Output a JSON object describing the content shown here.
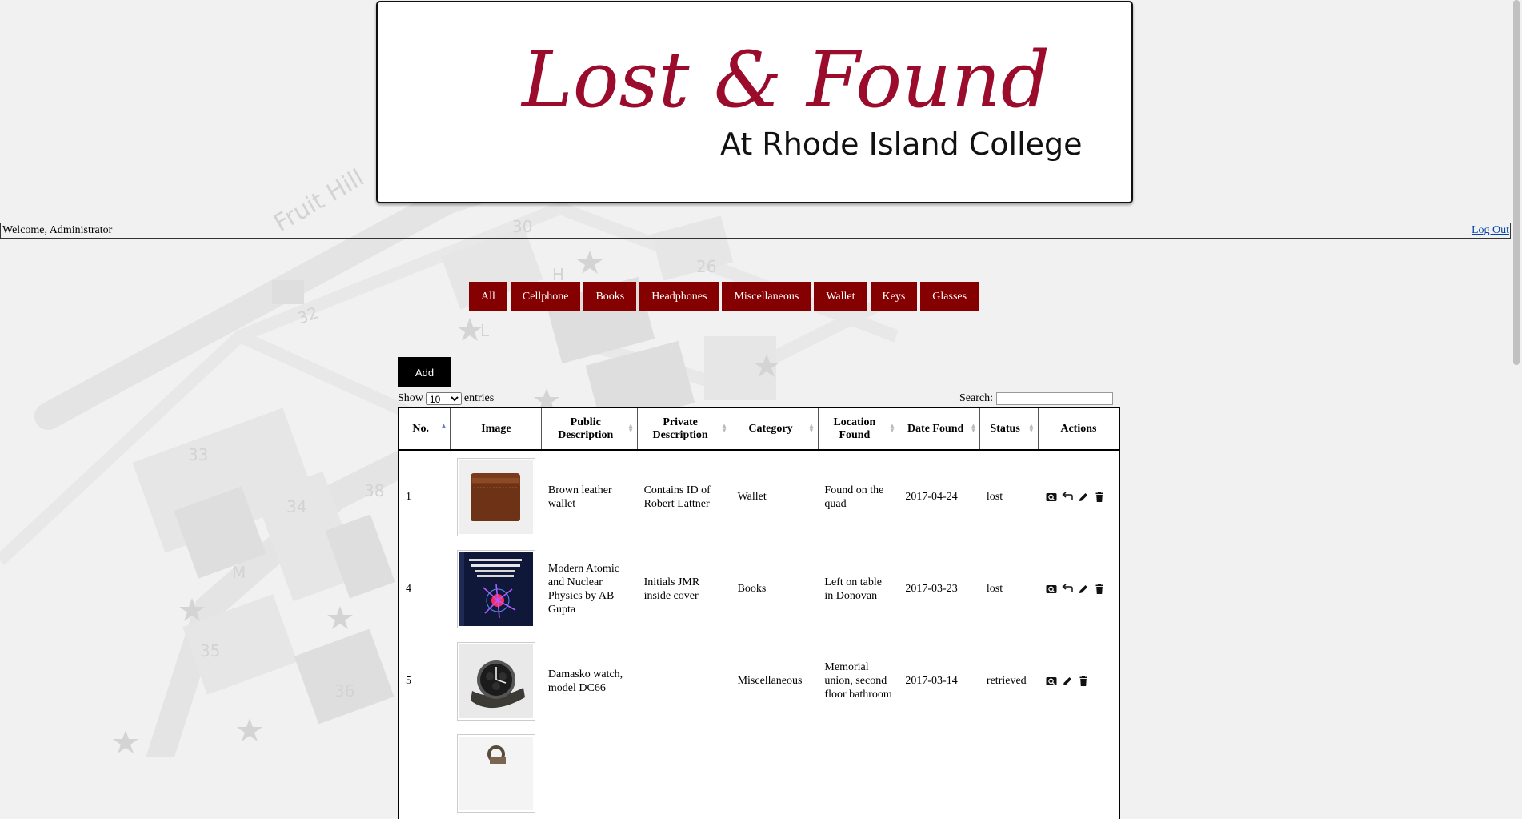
{
  "header": {
    "logo_title": "Lost & Found",
    "logo_subtitle": "At Rhode Island College"
  },
  "welcome": {
    "text": "Welcome, Administrator",
    "logout_label": "Log Out"
  },
  "categories": [
    "All",
    "Cellphone",
    "Books",
    "Headphones",
    "Miscellaneous",
    "Wallet",
    "Keys",
    "Glasses"
  ],
  "toolbar": {
    "add_label": "Add",
    "show_label": "Show",
    "entries_label": "entries",
    "page_size": "10",
    "search_label": "Search:",
    "search_value": ""
  },
  "table": {
    "columns": [
      "No.",
      "Image",
      "Public Description",
      "Private Description",
      "Category",
      "Location Found",
      "Date Found",
      "Status",
      "Actions"
    ],
    "rows": [
      {
        "no": "1",
        "image": "wallet",
        "public": "Brown leather wallet",
        "private": "Contains ID of Robert Lattner",
        "category": "Wallet",
        "location": "Found on the quad",
        "date": "2017-04-24",
        "status": "lost",
        "actions": [
          "view-icon",
          "return-icon",
          "edit-icon",
          "delete-icon"
        ]
      },
      {
        "no": "4",
        "image": "book",
        "public": "Modern Atomic and Nuclear Physics by AB Gupta",
        "private": "Initials JMR inside cover",
        "category": "Books",
        "location": "Left on table in Donovan",
        "date": "2017-03-23",
        "status": "lost",
        "actions": [
          "view-icon",
          "return-icon",
          "edit-icon",
          "delete-icon"
        ]
      },
      {
        "no": "5",
        "image": "watch",
        "public": "Damasko watch, model DC66",
        "private": "",
        "category": "Miscellaneous",
        "location": "Memorial union, second floor bathroom",
        "date": "2017-03-14",
        "status": "retrieved",
        "actions": [
          "view-icon",
          "edit-icon",
          "delete-icon"
        ]
      }
    ]
  },
  "background_map": {
    "labels": [
      "Fruit Hill",
      "30",
      "26",
      "32",
      "33",
      "34",
      "38",
      "35",
      "36",
      "M",
      "H",
      "L"
    ]
  },
  "colors": {
    "brand_red": "#850000",
    "logo_red": "#9b0c2c",
    "background": "#f1f1f1"
  }
}
